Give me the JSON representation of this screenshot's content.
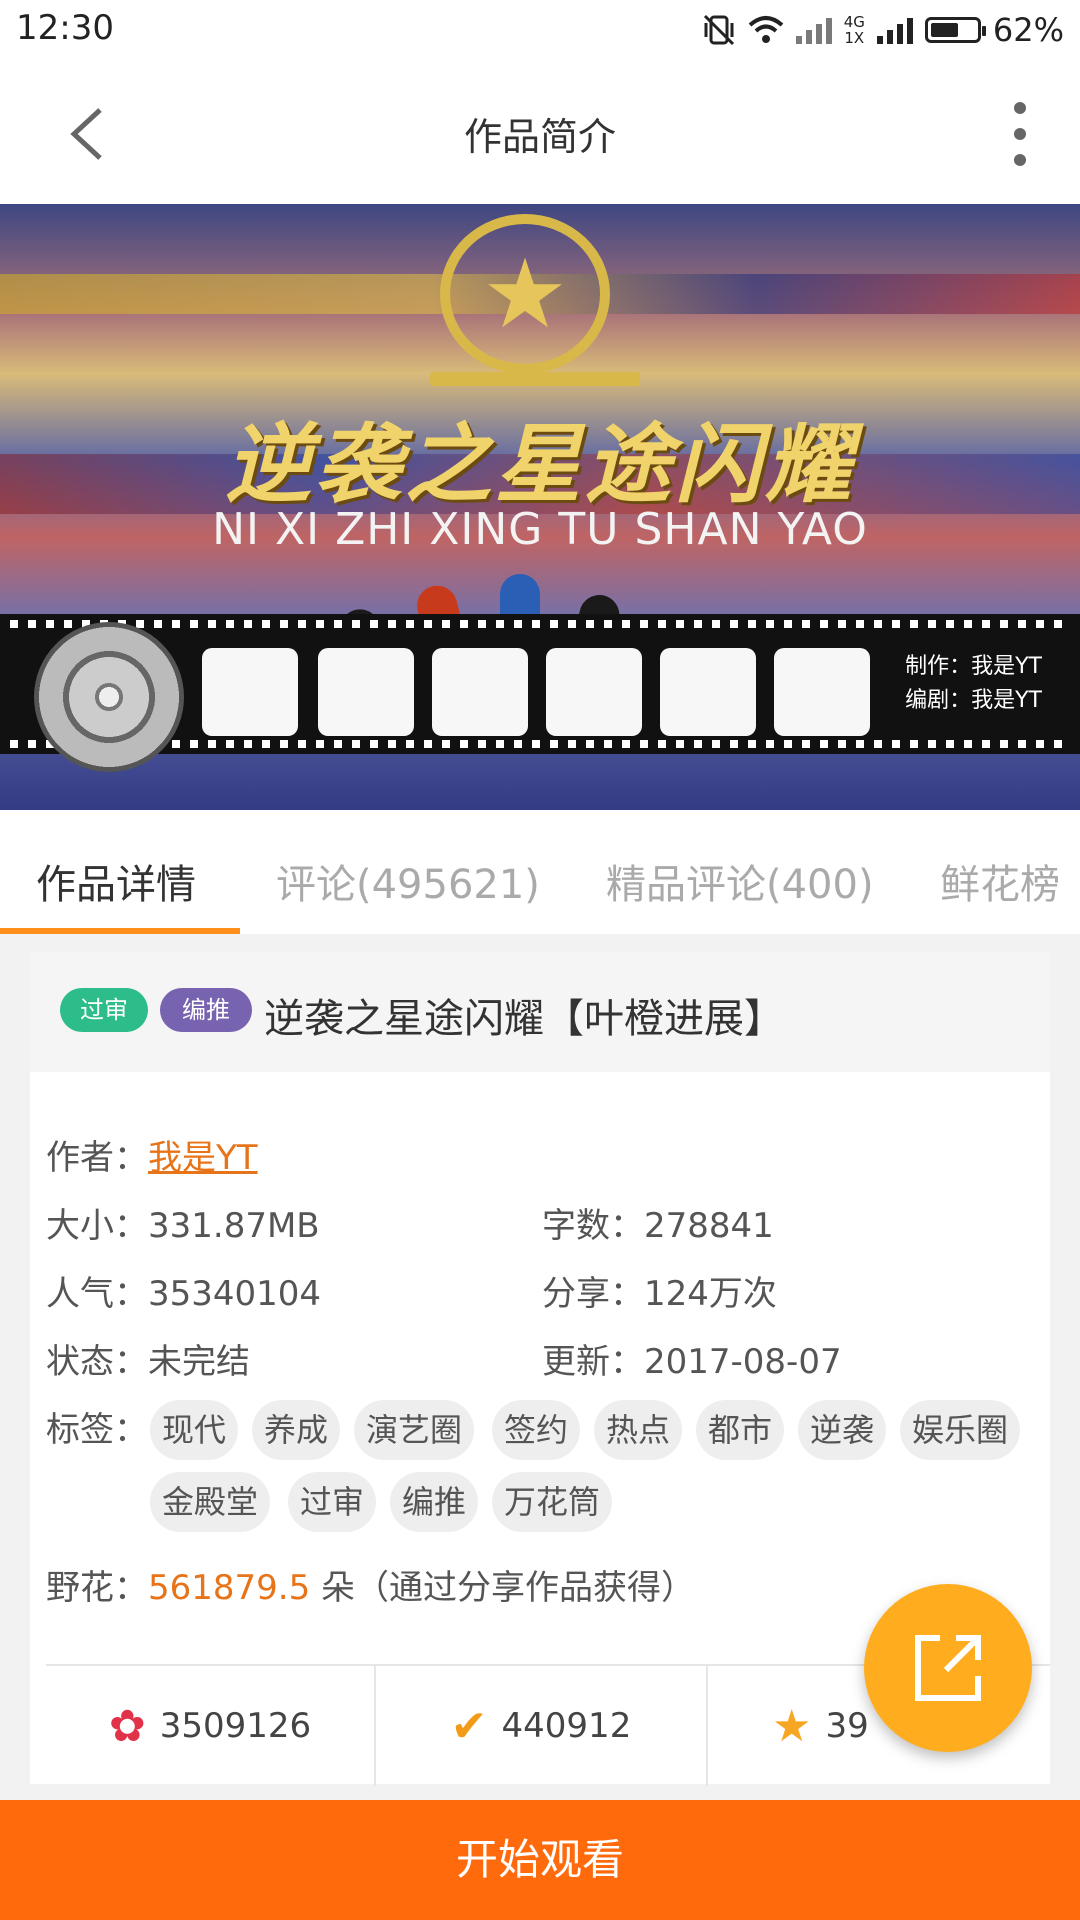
{
  "status_bar": {
    "time": "12:30",
    "network_top": "4G",
    "network_bottom": "1X",
    "battery_level": 0.62,
    "battery_text": "62%",
    "icons": [
      "vibrate-off-icon",
      "wifi-icon",
      "signal-icon",
      "battery-icon"
    ]
  },
  "header": {
    "title": "作品简介",
    "back_icon": "chevron-left-icon",
    "more_icon": "more-vertical-icon"
  },
  "banner": {
    "title": "逆袭之星途闪耀",
    "pinyin": "NI XI ZHI XING TU SHAN YAO",
    "credit_producer": "制作：我是YT",
    "credit_writer": "编剧：我是YT"
  },
  "tabs": [
    {
      "label": "作品详情",
      "active": true
    },
    {
      "label": "评论(495621)",
      "active": false
    },
    {
      "label": "精品评论(400)",
      "active": false
    },
    {
      "label": "鲜花榜",
      "active": false
    }
  ],
  "work": {
    "badges": [
      "过审",
      "编推"
    ],
    "title": "逆袭之星途闪耀【叶橙进展】",
    "author_label": "作者：",
    "author": "我是YT",
    "size_label": "大小：",
    "size": "331.87MB",
    "words_label": "字数：",
    "words": "278841",
    "popularity_label": "人气：",
    "popularity": "35340104",
    "shares_label": "分享：",
    "shares": "124万次",
    "status_label": "状态：",
    "status": "未完结",
    "updated_label": "更新：",
    "updated": "2017-08-07",
    "tags_label": "标签：",
    "tags": [
      "现代",
      "养成",
      "演艺圈",
      "签约",
      "热点",
      "都市",
      "逆袭",
      "娱乐圈",
      "金殿堂",
      "过审",
      "编推",
      "万花筒"
    ],
    "wildflowers_label": "野花：",
    "wildflowers": "561879.5",
    "wildflowers_suffix": "朵（通过分享作品获得）"
  },
  "stats": [
    {
      "icon": "rose-icon",
      "value": "3509126"
    },
    {
      "icon": "thumbs-up-icon",
      "value": "440912"
    },
    {
      "icon": "star-icon",
      "value": "39"
    }
  ],
  "share_fab_icon": "share-icon",
  "cta": "开始观看"
}
